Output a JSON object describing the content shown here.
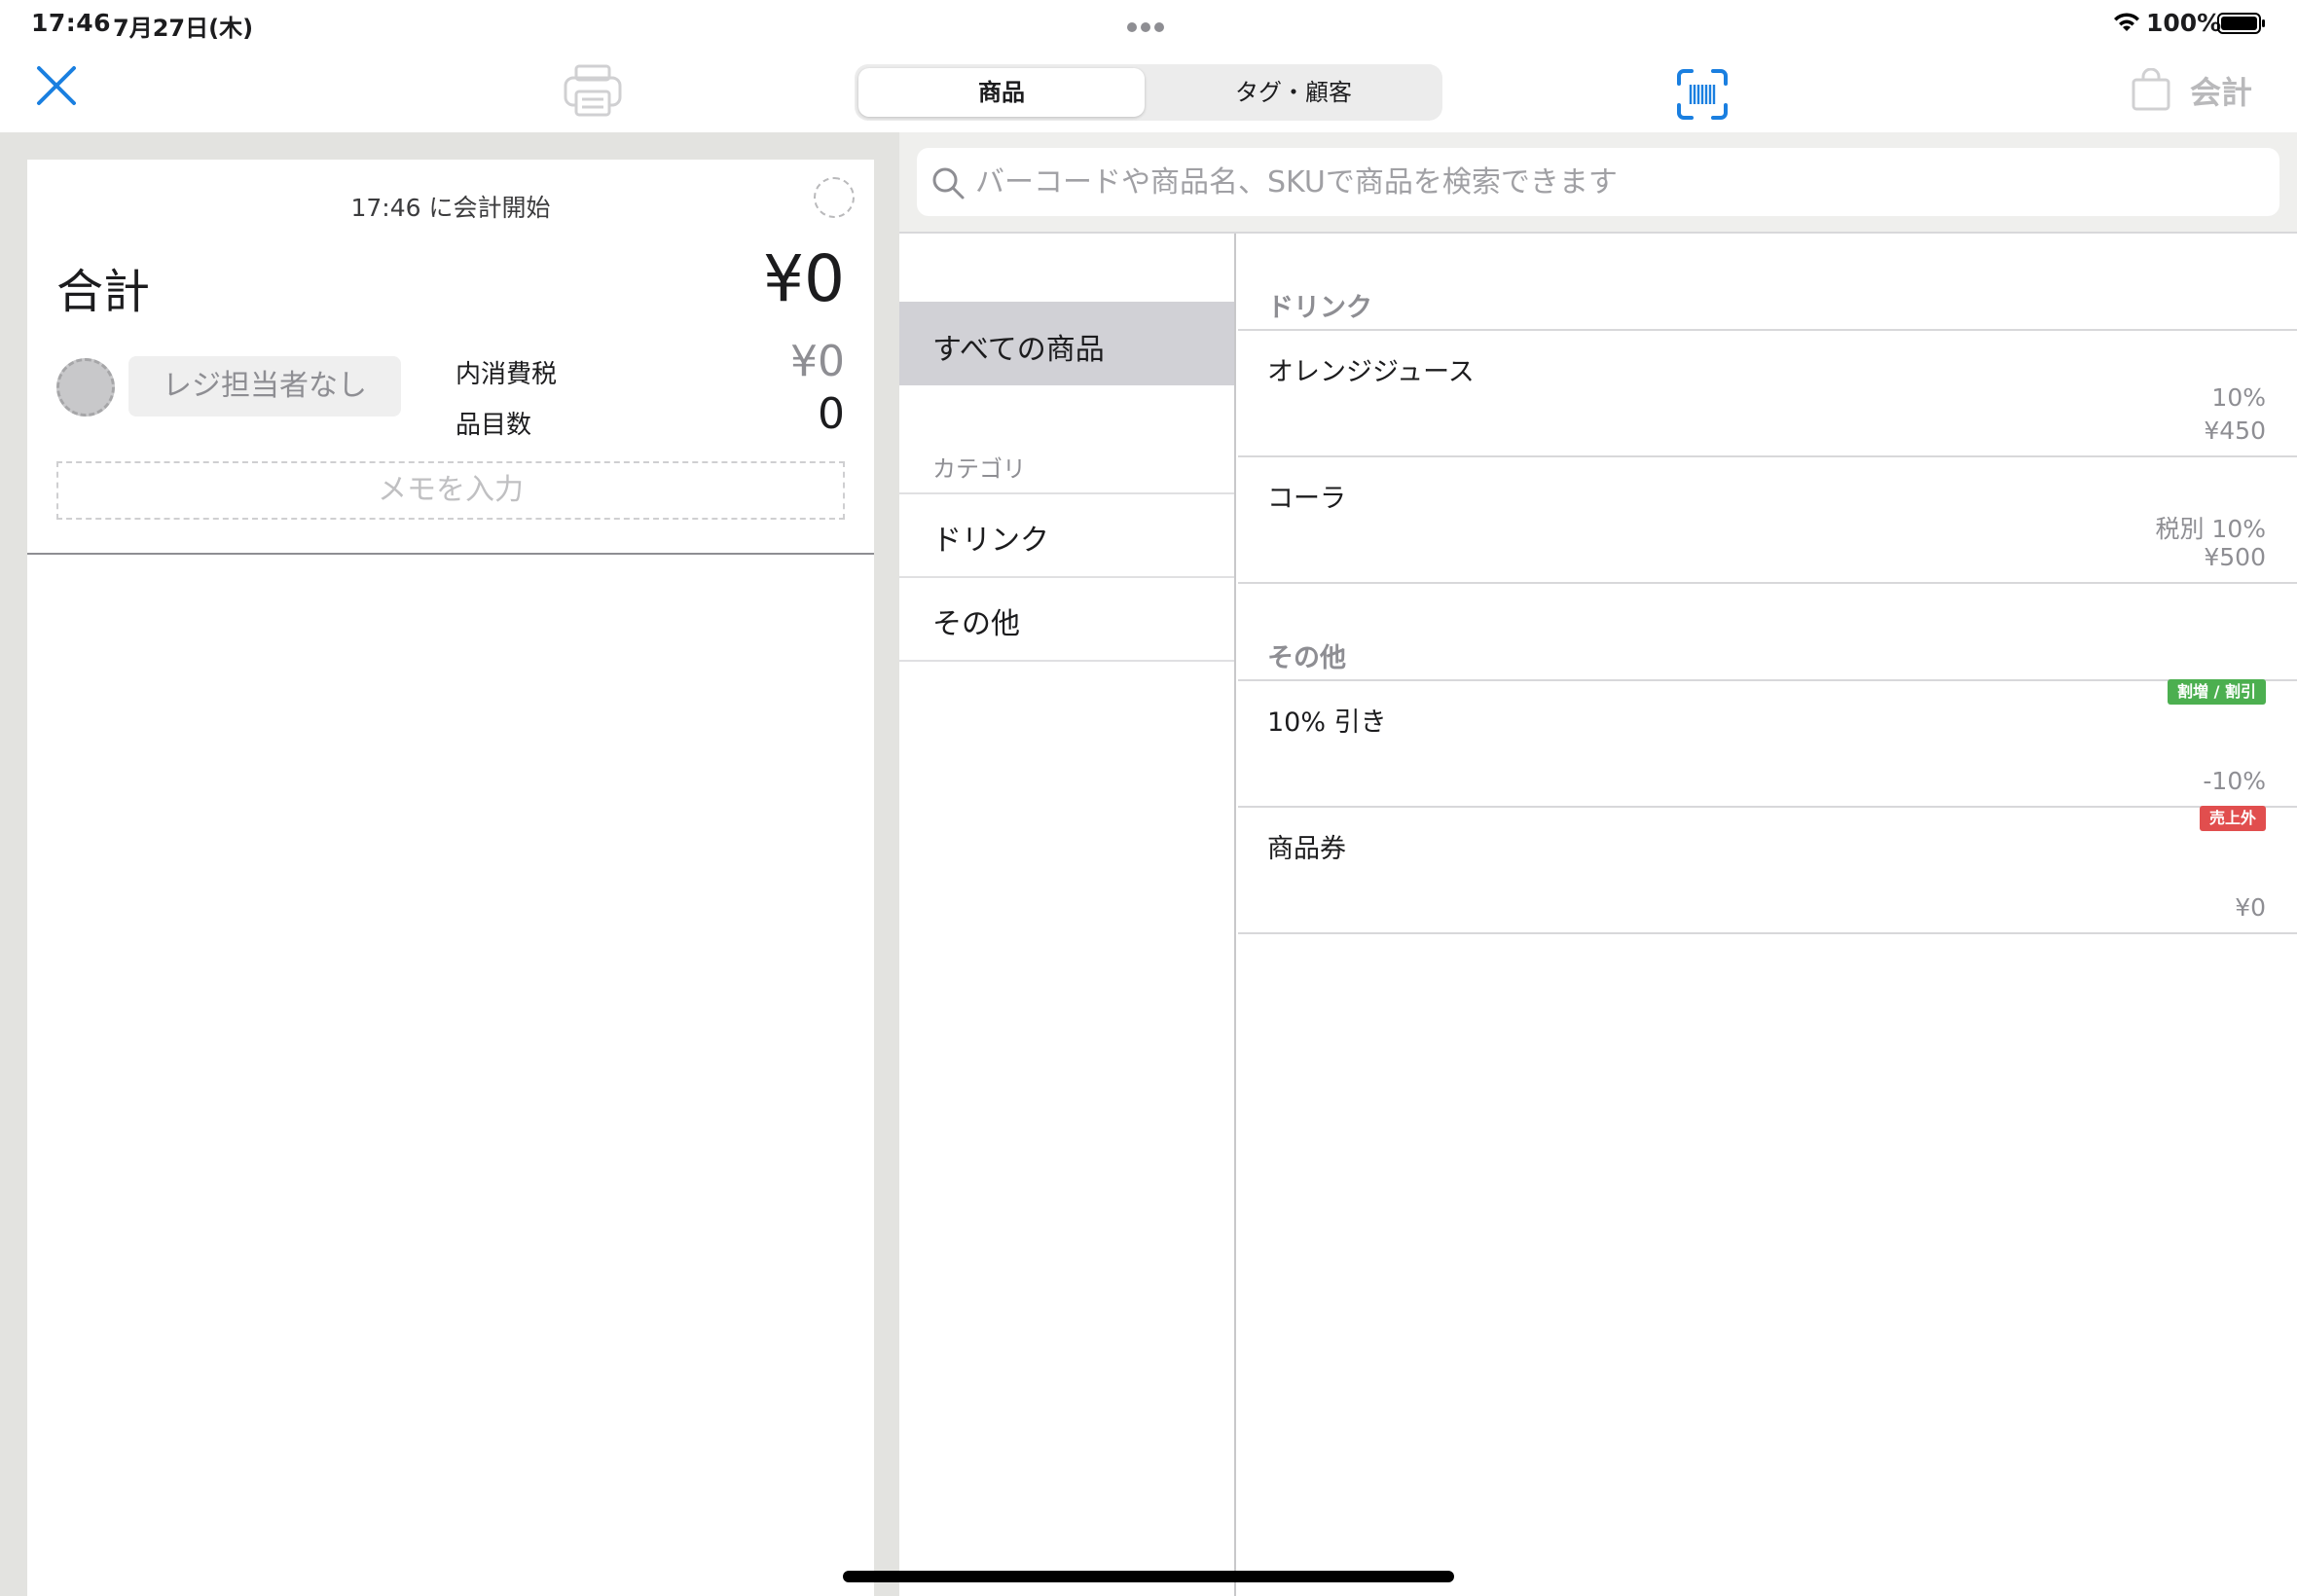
{
  "status_bar": {
    "time": "17:46",
    "date": "7月27日(木)",
    "battery": "100%"
  },
  "toolbar": {
    "tabs": [
      {
        "label": "商品",
        "active": true
      },
      {
        "label": "タグ・顧客",
        "active": false
      }
    ],
    "checkout_label": "会計"
  },
  "receipt": {
    "start_time": "17:46",
    "start_suffix": "に会計開始",
    "total_label": "合計",
    "total_value": "¥0",
    "cashier_placeholder": "レジ担当者なし",
    "tax_label": "内消費税",
    "tax_value": "¥0",
    "count_label": "品目数",
    "count_value": "0",
    "memo_placeholder": "メモを入力"
  },
  "search": {
    "placeholder": "バーコードや商品名、SKUで商品を検索できます"
  },
  "categories": {
    "all_label": "すべての商品",
    "header": "カテゴリ",
    "items": [
      "ドリンク",
      "その他"
    ]
  },
  "products": {
    "sections": [
      {
        "title": "ドリンク",
        "items": [
          {
            "name": "オレンジジュース",
            "tax": "10%",
            "price": "¥450"
          },
          {
            "name": "コーラ",
            "tax": "税別 10%",
            "price": "¥500"
          }
        ]
      },
      {
        "title": "その他",
        "items": [
          {
            "name": "10% 引き",
            "badge": "割増 / 割引",
            "price": "-10%"
          },
          {
            "name": "商品券",
            "badge": "売上外",
            "price": "¥0"
          }
        ]
      }
    ]
  },
  "colors": {
    "accent": "#1a7fe0",
    "badge_discount": "#4caf50",
    "badge_non_sales": "#e14e4e",
    "selected_category": "#d1d1d6"
  },
  "icons": {
    "close": "close-icon",
    "print": "printer-icon",
    "scan": "barcode-scan-icon",
    "bag": "shopping-bag-icon",
    "search": "search-icon"
  }
}
